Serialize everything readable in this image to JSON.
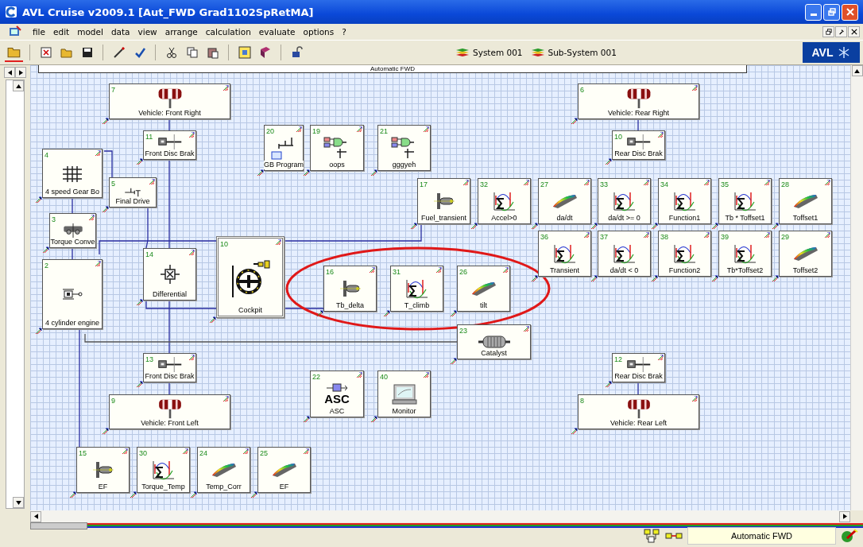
{
  "window": {
    "title": "AVL Cruise v2009.1 [Aut_FWD Grad1102SpRetMA]"
  },
  "menu": [
    "file",
    "edit",
    "model",
    "data",
    "view",
    "arrange",
    "calculation",
    "evaluate",
    "options",
    "?"
  ],
  "toolbar": {
    "systems": [
      "System 001",
      "Sub-System 001"
    ],
    "logo": "AVL"
  },
  "canvas": {
    "header": "Automatic FWD",
    "nodes": [
      {
        "number": "7",
        "label": "Vehicle: Front Right",
        "kind": "wheel"
      },
      {
        "number": "6",
        "label": "Vehicle: Rear Right",
        "kind": "wheel"
      },
      {
        "number": "20",
        "label": "GB Program",
        "kind": "program"
      },
      {
        "number": "19",
        "label": "oops",
        "kind": "logic"
      },
      {
        "number": "21",
        "label": "gggyeh",
        "kind": "logic"
      },
      {
        "number": "11",
        "label": "Front Disc Brak",
        "kind": "brake"
      },
      {
        "number": "10",
        "label": "Rear Disc Brak",
        "kind": "brake"
      },
      {
        "number": "4",
        "label": "4 speed Gear Bo",
        "kind": "gearbox"
      },
      {
        "number": "5",
        "label": "Final Drive",
        "kind": "final_drive"
      },
      {
        "number": "17",
        "label": "Fuel_transient",
        "kind": "injector"
      },
      {
        "number": "32",
        "label": "Accel>0",
        "kind": "function"
      },
      {
        "number": "27",
        "label": "da/dt",
        "kind": "map"
      },
      {
        "number": "33",
        "label": "da/dt >= 0",
        "kind": "function"
      },
      {
        "number": "34",
        "label": "Function1",
        "kind": "function"
      },
      {
        "number": "35",
        "label": "Tb * Toffset1",
        "kind": "function"
      },
      {
        "number": "28",
        "label": "Toffset1",
        "kind": "map"
      },
      {
        "number": "3",
        "label": "Torque Conve",
        "kind": "torque_converter"
      },
      {
        "number": "36",
        "label": "Transient",
        "kind": "function"
      },
      {
        "number": "37",
        "label": "da/dt < 0",
        "kind": "function"
      },
      {
        "number": "38",
        "label": "Function2",
        "kind": "function"
      },
      {
        "number": "39",
        "label": "Tb*Toffset2",
        "kind": "function"
      },
      {
        "number": "29",
        "label": "Toffset2",
        "kind": "map"
      },
      {
        "number": "10",
        "label": "Cockpit",
        "kind": "cockpit"
      },
      {
        "number": "14",
        "label": "Differential",
        "kind": "differential"
      },
      {
        "number": "2",
        "label": "4 cylinder engine",
        "kind": "engine"
      },
      {
        "number": "16",
        "label": "Tb_delta",
        "kind": "injector"
      },
      {
        "number": "31",
        "label": "T_climb",
        "kind": "function"
      },
      {
        "number": "26",
        "label": "tilt",
        "kind": "map"
      },
      {
        "number": "23",
        "label": "Catalyst",
        "kind": "catalyst"
      },
      {
        "number": "13",
        "label": "Front Disc Brak",
        "kind": "brake"
      },
      {
        "number": "12",
        "label": "Rear Disc Brak",
        "kind": "brake"
      },
      {
        "number": "22",
        "label": "ASC",
        "kind": "asc",
        "icon_text": "ASC"
      },
      {
        "number": "40",
        "label": "Monitor",
        "kind": "monitor"
      },
      {
        "number": "9",
        "label": "Vehicle: Front Left",
        "kind": "wheel"
      },
      {
        "number": "8",
        "label": "Vehicle: Rear Left",
        "kind": "wheel"
      },
      {
        "number": "15",
        "label": "EF",
        "kind": "injector"
      },
      {
        "number": "30",
        "label": "Torque_Temp",
        "kind": "function"
      },
      {
        "number": "24",
        "label": "Temp_Corr",
        "kind": "map"
      },
      {
        "number": "25",
        "label": "EF",
        "kind": "map"
      }
    ]
  },
  "status_bar": {
    "mode": "Automatic FWD"
  }
}
